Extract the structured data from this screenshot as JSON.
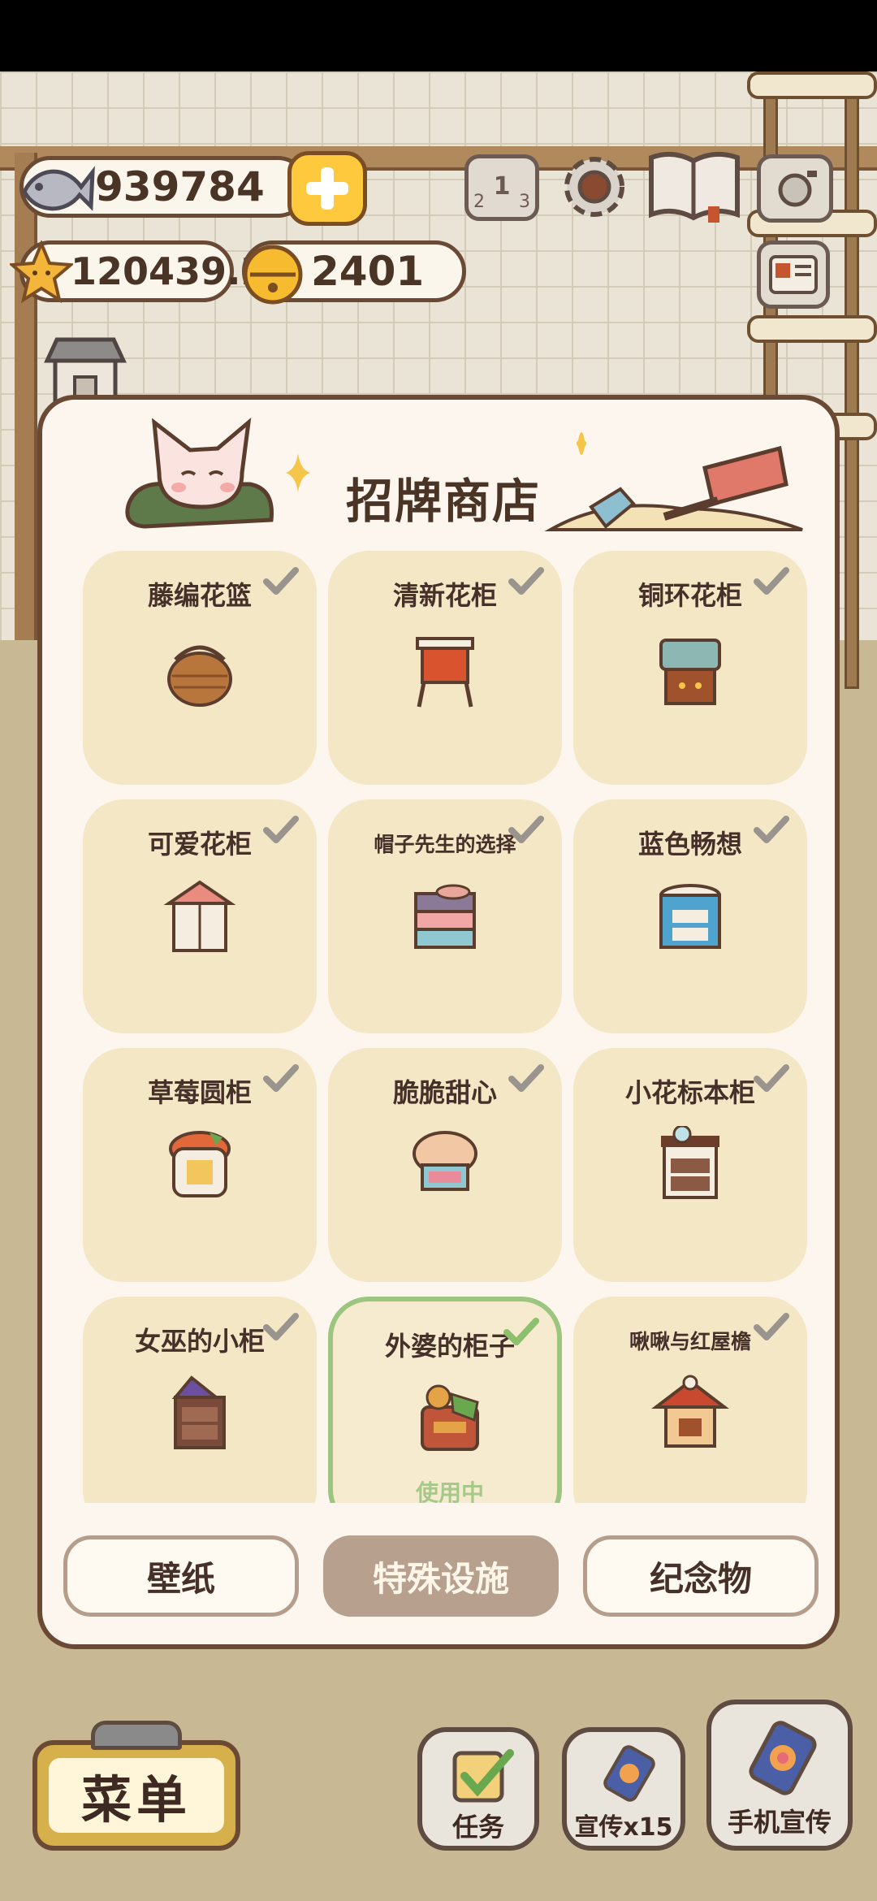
{
  "hud": {
    "fish": "939784",
    "stars": "120439.2",
    "bells": "2401",
    "add_label": "+"
  },
  "top_icons": [
    "ranking-icon",
    "settings-gear-icon",
    "catalog-book-icon",
    "camera-icon",
    "id-card-icon"
  ],
  "panel": {
    "title": "招牌商店",
    "items": [
      {
        "name": "藤编花篮",
        "owned": true,
        "art": "basket",
        "status": ""
      },
      {
        "name": "清新花柜",
        "owned": true,
        "art": "cabinet-fresh",
        "status": ""
      },
      {
        "name": "铜环花柜",
        "owned": true,
        "art": "cabinet-brass",
        "status": ""
      },
      {
        "name": "可爱花柜",
        "owned": true,
        "art": "cabinet-cute",
        "status": ""
      },
      {
        "name": "帽子先生的选择",
        "owned": true,
        "art": "dresser-hat",
        "status": ""
      },
      {
        "name": "蓝色畅想",
        "owned": true,
        "art": "barrel-blue",
        "status": ""
      },
      {
        "name": "草莓圆柜",
        "owned": true,
        "art": "strawberry",
        "status": ""
      },
      {
        "name": "脆脆甜心",
        "owned": true,
        "art": "cookie",
        "status": ""
      },
      {
        "name": "小花标本柜",
        "owned": true,
        "art": "specimen",
        "status": ""
      },
      {
        "name": "女巫的小柜",
        "owned": true,
        "art": "witch",
        "status": ""
      },
      {
        "name": "外婆的柜子",
        "owned": true,
        "art": "grandma",
        "status": "使用中"
      },
      {
        "name": "啾啾与红屋檐",
        "owned": true,
        "art": "red-eave",
        "status": ""
      }
    ],
    "tabs": [
      {
        "label": "壁纸",
        "active": false
      },
      {
        "label": "特殊设施",
        "active": true
      },
      {
        "label": "纪念物",
        "active": false
      }
    ]
  },
  "bottom": {
    "menu": "菜单",
    "tasks": "任务",
    "promo": "宣传x15",
    "phone_promo": "手机宣传"
  },
  "colors": {
    "outline": "#6b4a35",
    "card_bg": "#f4e7c6",
    "selected_border": "#9cc57f",
    "active_tab": "#b7a08d"
  }
}
